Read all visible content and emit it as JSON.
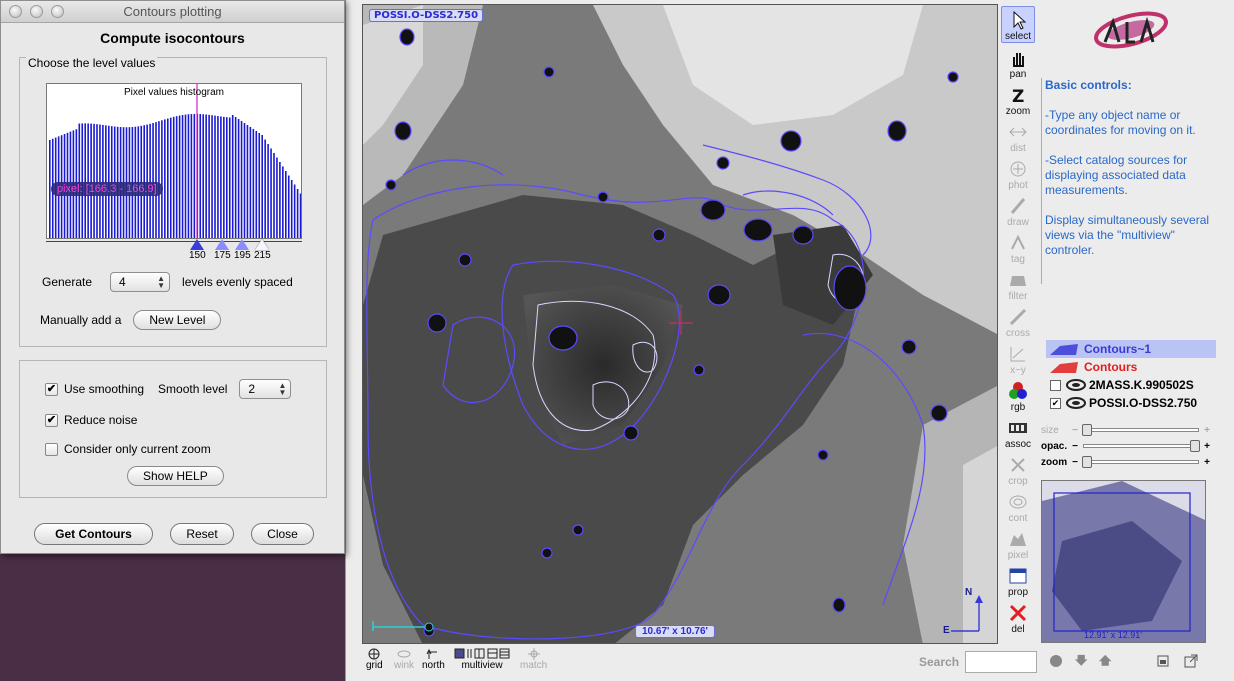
{
  "dialog": {
    "title": "Contours plotting",
    "heading": "Compute isocontours",
    "level_box_title": "Choose the level values",
    "histogram_title": "Pixel values histogram",
    "pixel_readout": "pixel: [166.3 - 166.9]",
    "markers": [
      "150",
      "175",
      "195",
      "215"
    ],
    "generate_label": "Generate",
    "levels_count": "4",
    "levels_suffix": "levels evenly spaced",
    "manual_label": "Manually add a",
    "new_level_button": "New Level",
    "use_smoothing": {
      "label": "Use smoothing",
      "checked": true
    },
    "smooth_level_label": "Smooth level",
    "smooth_level_value": "2",
    "reduce_noise": {
      "label": "Reduce noise",
      "checked": true
    },
    "current_zoom": {
      "label": "Consider only current zoom",
      "checked": false
    },
    "show_help_button": "Show HELP",
    "get_contours_button": "Get Contours",
    "reset_button": "Reset",
    "close_button": "Close"
  },
  "view": {
    "survey_label": "POSSI.O-DSS2.750",
    "fov_label": "10.67' x 10.76'",
    "compass_n": "N",
    "compass_e": "E"
  },
  "toolbar": [
    {
      "name": "select",
      "enabled": true,
      "active": true
    },
    {
      "name": "pan",
      "enabled": true
    },
    {
      "name": "zoom",
      "enabled": true
    },
    {
      "name": "dist",
      "enabled": false
    },
    {
      "name": "phot",
      "enabled": false
    },
    {
      "name": "draw",
      "enabled": false
    },
    {
      "name": "tag",
      "enabled": false
    },
    {
      "name": "filter",
      "enabled": false
    },
    {
      "name": "cross",
      "enabled": false
    },
    {
      "name": "x~y",
      "enabled": false
    },
    {
      "name": "rgb",
      "enabled": true
    },
    {
      "name": "assoc",
      "enabled": true
    },
    {
      "name": "crop",
      "enabled": false
    },
    {
      "name": "cont",
      "enabled": false
    },
    {
      "name": "pixel",
      "enabled": false
    },
    {
      "name": "prop",
      "enabled": true
    },
    {
      "name": "del",
      "enabled": true
    }
  ],
  "help": {
    "title": "Basic controls:",
    "paragraphs": [
      "-Type any object name or coordinates for moving on it.",
      "-Select catalog sources for displaying associated data measurements.",
      "Display simultaneously several views via the \"multiview\" controler."
    ]
  },
  "layers": [
    {
      "name": "Contours~1",
      "color": "#3a3ad6",
      "selected": true,
      "checkbox": false
    },
    {
      "name": "Contours",
      "color": "#e02020",
      "selected": false,
      "checkbox": false
    },
    {
      "name": "2MASS.K.990502S",
      "color": "#000000",
      "selected": false,
      "checkbox": true,
      "checked": false
    },
    {
      "name": "POSSI.O-DSS2.750",
      "color": "#000000",
      "selected": false,
      "checkbox": true,
      "checked": true
    }
  ],
  "sliders": {
    "size_label": "size",
    "opac_label": "opac.",
    "zoom_label": "zoom",
    "opac_level": 0.97,
    "zoom_level": 0.03,
    "size_level": 0.03
  },
  "overview_label": "12.91' x 12.91'",
  "bottom": {
    "grid": "grid",
    "wink": "wink",
    "north": "north",
    "multiview": "multiview",
    "match": "match",
    "search_label": "Search",
    "search_value": ""
  },
  "colors": {
    "contour": "#5a4bff",
    "contour_inner": "#d8d8ff",
    "help_text": "#2a68c8"
  }
}
